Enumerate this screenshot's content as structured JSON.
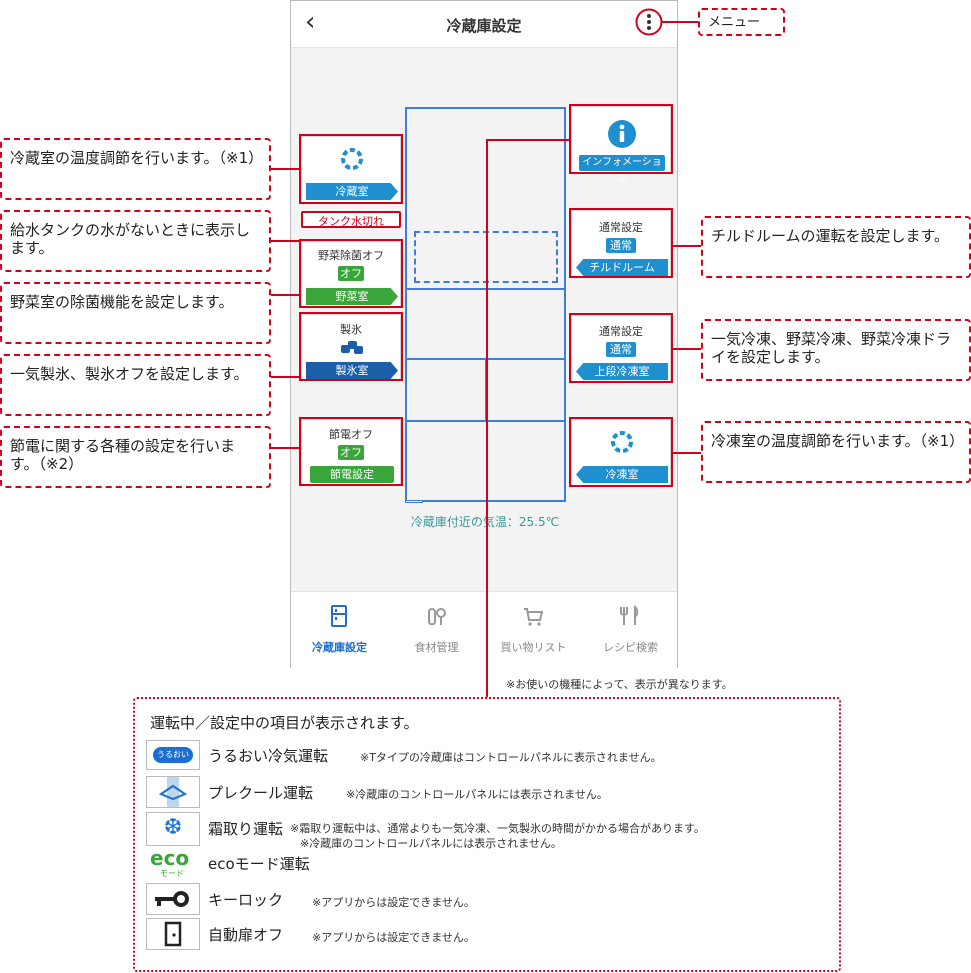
{
  "phone": {
    "title": "冷蔵庫設定",
    "temp_text": "冷蔵庫付近の気温：25.5℃",
    "left_controls": {
      "fridge_room": {
        "label": "冷蔵室",
        "icon": "refresh-ring-icon"
      },
      "tank_warning": "タンク水切れ",
      "vegetable": {
        "top": "野菜除菌オフ",
        "status": "オフ",
        "label": "野菜室"
      },
      "ice": {
        "top": "製氷",
        "label": "製氷室",
        "icon": "ice-icon"
      },
      "power": {
        "top": "節電オフ",
        "status": "オフ",
        "label": "節電設定"
      }
    },
    "right_controls": {
      "info": {
        "label": "インフォメーション",
        "icon": "info-icon"
      },
      "chilled": {
        "top": "通常設定",
        "status": "通常",
        "label": "チルドルーム"
      },
      "upper_freezer": {
        "top": "通常設定",
        "status": "通常",
        "label": "上段冷凍室"
      },
      "freezer": {
        "label": "冷凍室",
        "icon": "refresh-ring-icon"
      }
    },
    "nav": [
      {
        "label": "冷蔵庫設定",
        "icon": "fridge-icon",
        "active": true
      },
      {
        "label": "食材管理",
        "icon": "food-icon",
        "active": false
      },
      {
        "label": "買い物リスト",
        "icon": "cart-icon",
        "active": false
      },
      {
        "label": "レシピ検索",
        "icon": "utensils-icon",
        "active": false
      }
    ]
  },
  "callouts": {
    "menu": "メニュー",
    "fridge_temp": "冷蔵室の温度調節を行います。（※1）",
    "tank": "給水タンクの水がないときに表示します。",
    "vegetable": "野菜室の除菌機能を設定します。",
    "ice": "一気製氷、製氷オフを設定します。",
    "power": "節電に関する各種の設定を行います。（※2）",
    "chilled": "チルドルームの運転を設定します。",
    "upper_freezer": "一気冷凍、野菜冷凍、野菜冷凍ドライを設定します。",
    "freezer": "冷凍室の温度調節を行います。（※1）"
  },
  "model_note": "※お使いの機種によって、表示が異なります。",
  "legend": {
    "title": "運転中／設定中の項目が表示されます。",
    "items": [
      {
        "name": "うるおい冷気運転",
        "note": "※Tタイプの冷蔵庫はコントロールパネルに表示されません。",
        "icon_text": "うるおい"
      },
      {
        "name": "プレクール運転",
        "note": "※冷蔵庫のコントロールパネルには表示されません。"
      },
      {
        "name": "霜取り運転",
        "note": "※霜取り運転中は、通常よりも一気冷凍、一気製氷の時間がかかる場合があります。",
        "note2": "※冷蔵庫のコントロールパネルには表示されません。"
      },
      {
        "name": "ecoモード運転",
        "icon_text": "eco",
        "icon_sub": "モード"
      },
      {
        "name": "キーロック",
        "note": "※アプリからは設定できません。"
      },
      {
        "name": "自動扉オフ",
        "note": "※アプリからは設定できません。"
      }
    ]
  },
  "colors": {
    "accent": "#1c6fd1",
    "arrow_blue": "#1f8fd0",
    "dark_blue": "#1a5fa8",
    "green": "#3aa53a",
    "red": "#d0021b",
    "teal_text": "#3a9a9a"
  }
}
